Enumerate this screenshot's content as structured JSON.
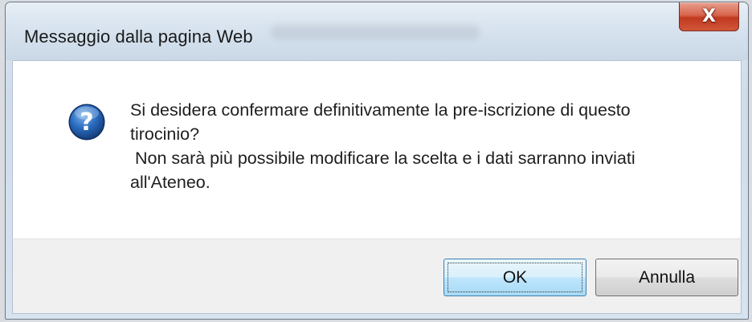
{
  "window": {
    "title": "Messaggio dalla pagina Web",
    "close_label": "X"
  },
  "dialog": {
    "icon": "question-icon",
    "message_lines": [
      "Si desidera confermare definitivamente la pre-iscrizione di questo",
      "tirocinio?",
      " Non sarà più possibile modificare la scelta e i dati sarranno inviati",
      "all'Ateneo."
    ]
  },
  "buttons": {
    "ok_label": "OK",
    "cancel_label": "Annulla"
  },
  "colors": {
    "close_button": "#c0391f",
    "icon_blue": "#1f5fa8",
    "ok_border": "#3c7fb1"
  }
}
